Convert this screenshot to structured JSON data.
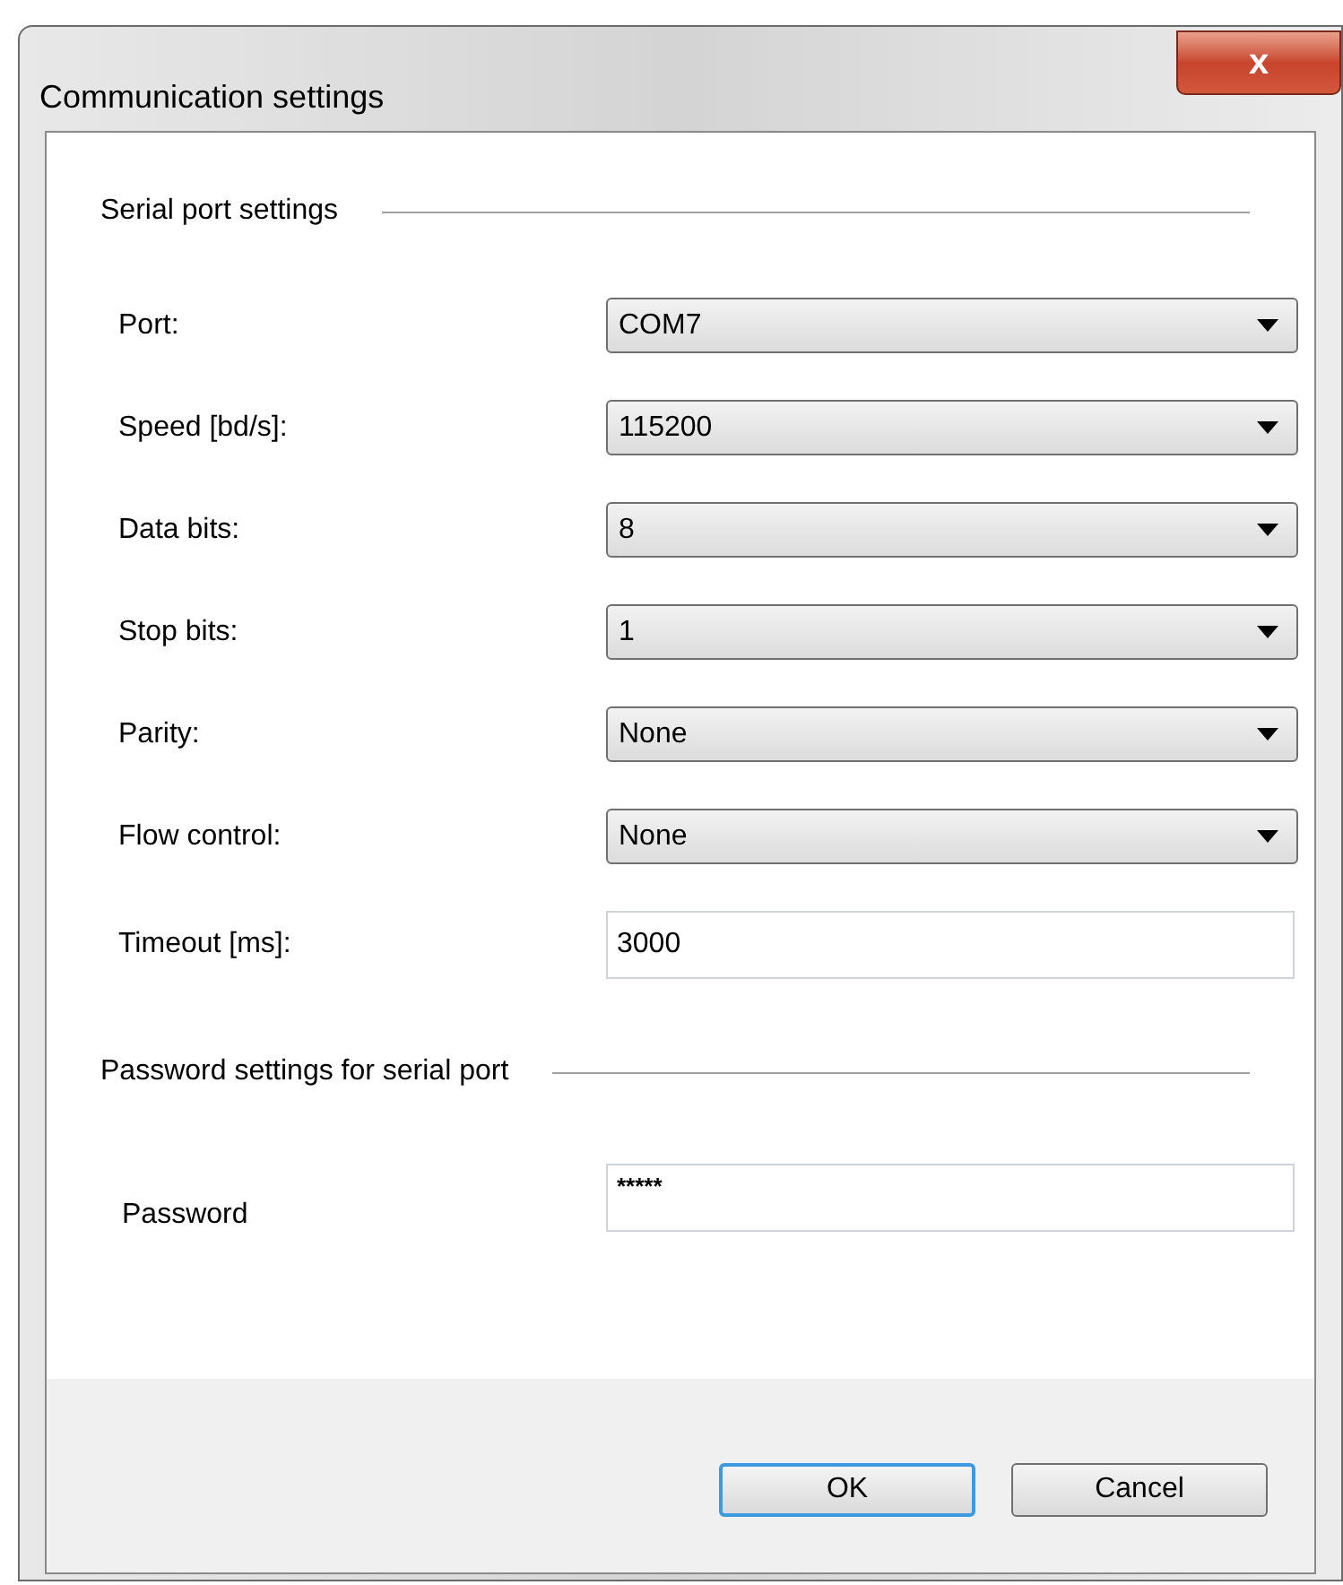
{
  "window": {
    "title": "Communication settings",
    "close": "x"
  },
  "sections": [
    {
      "heading": "Serial port settings",
      "fields": [
        {
          "label": "Port:",
          "kind": "combo",
          "value": "COM7"
        },
        {
          "label": "Speed [bd/s]:",
          "kind": "combo",
          "value": "115200"
        },
        {
          "label": "Data bits:",
          "kind": "combo",
          "value": "8"
        },
        {
          "label": "Stop bits:",
          "kind": "combo",
          "value": "1"
        },
        {
          "label": "Parity:",
          "kind": "combo",
          "value": "None"
        },
        {
          "label": "Flow control:",
          "kind": "combo",
          "value": "None"
        },
        {
          "label": "Timeout [ms]:",
          "kind": "text",
          "value": "3000"
        }
      ]
    },
    {
      "heading": "Password settings for serial port",
      "fields": [
        {
          "label": "Password",
          "kind": "password",
          "value": "*****"
        }
      ]
    }
  ],
  "buttons": [
    {
      "label": "OK",
      "default": true
    },
    {
      "label": "Cancel",
      "default": false
    }
  ]
}
